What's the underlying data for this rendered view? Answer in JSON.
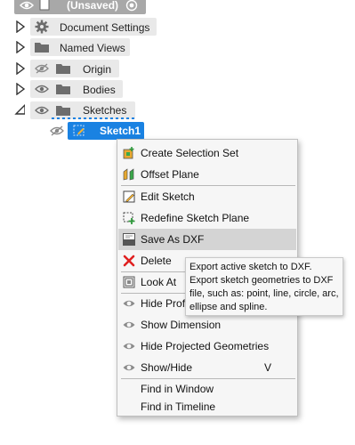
{
  "browser": {
    "root_label": "(Unsaved)",
    "items": [
      {
        "label": "Document Settings",
        "icon": "gear-icon"
      },
      {
        "label": "Named Views",
        "icon": "folder-icon"
      },
      {
        "label": "Origin",
        "icon": "folder-icon"
      },
      {
        "label": "Bodies",
        "icon": "folder-icon"
      },
      {
        "label": "Sketches",
        "icon": "folder-icon"
      }
    ],
    "selected_item": "Sketch1"
  },
  "context_menu": {
    "items": [
      {
        "label": "Create Selection Set",
        "icon": "selection-set-icon"
      },
      {
        "label": "Offset Plane",
        "icon": "offset-plane-icon"
      },
      {
        "label": "Edit Sketch",
        "icon": "edit-sketch-icon"
      },
      {
        "label": "Redefine Sketch Plane",
        "icon": "redefine-plane-icon"
      },
      {
        "label": "Save As DXF",
        "icon": "dxf-icon"
      },
      {
        "label": "Delete",
        "icon": "delete-icon"
      },
      {
        "label": "Look At",
        "icon": "look-at-icon"
      },
      {
        "label": "Hide Profile",
        "icon": "eye-icon"
      },
      {
        "label": "Show Dimension",
        "icon": "eye-icon"
      },
      {
        "label": "Hide Projected Geometries",
        "icon": "eye-icon"
      },
      {
        "label": "Show/Hide",
        "icon": "eye-icon",
        "shortcut": "V"
      },
      {
        "label": "Find in Window"
      },
      {
        "label": "Find in Timeline"
      }
    ],
    "highlighted": "Save As DXF"
  },
  "tooltip": {
    "lines": [
      "Export active sketch to DXF.",
      "Export sketch geometries to DXF",
      "file, such as: point, line, circle, arc,",
      "ellipse and spline."
    ]
  },
  "colors": {
    "selection": "#1a82e2",
    "delete_red": "#e02020",
    "pill_grey": "#e9e9e9"
  }
}
